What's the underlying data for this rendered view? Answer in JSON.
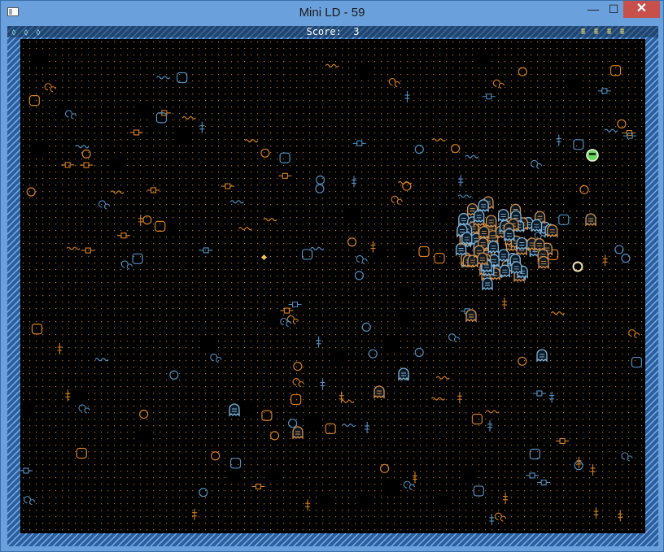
{
  "window": {
    "title": "Mini LD - 59",
    "minimize_glyph": "—",
    "maximize_glyph": "☐",
    "close_glyph": "✕"
  },
  "hud": {
    "lives_glyphs": [
      "⬨",
      "⬨",
      "⬨"
    ],
    "score_label": "Score:",
    "score_value": "3",
    "bomb_glyphs": [
      "⩩",
      "⩩",
      "⩩",
      "⩩"
    ]
  },
  "colors": {
    "border_blue": "#2b5fa0",
    "border_light": "#7bb1e6",
    "grid_dot": "#b07820",
    "circuit_orange": "#d6801e",
    "circuit_blue": "#4f8fc3",
    "enemy_blue": "#7fb3d9",
    "enemy_orange": "#d69048",
    "player": "#6fd860"
  },
  "icons": {
    "lives": "gem-icon",
    "bombs": "bomb-icon",
    "player": "player-ship-icon",
    "target": "ring-target-icon"
  }
}
